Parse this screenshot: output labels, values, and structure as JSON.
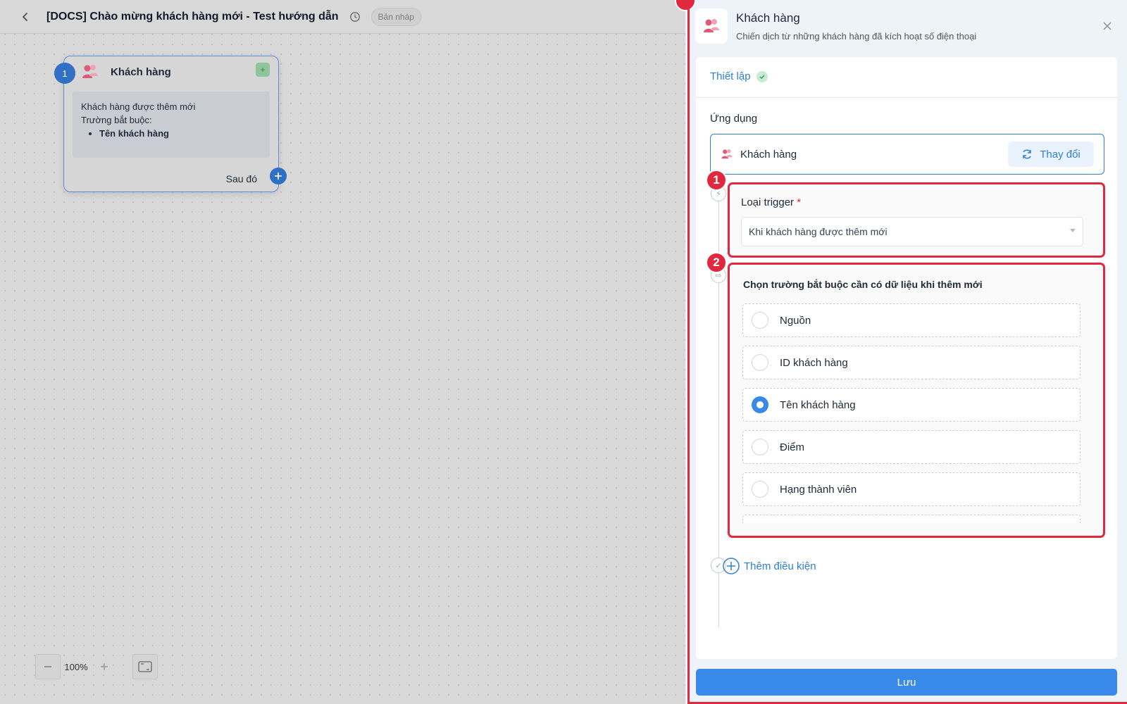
{
  "header": {
    "title": "[DOCS] Chào mừng khách hàng mới - Test hướng dẫn",
    "status_badge": "Bản nháp"
  },
  "node": {
    "step": "1",
    "title": "Khách hàng",
    "description": "Khách hàng được thêm mới",
    "required_label": "Trường bắt buộc:",
    "required_fields": [
      "Tên khách hàng"
    ],
    "next_label": "Sau đó"
  },
  "zoom": {
    "value": "100%"
  },
  "panel": {
    "title": "Khách hàng",
    "subtitle": "Chiến dịch từ những khách hàng đã kích hoạt số điện thoại",
    "tab_label": "Thiết lập",
    "app_section_label": "Ứng dụng",
    "app_name": "Khách hàng",
    "change_label": "Thay đổi",
    "trigger": {
      "badge": "1",
      "label": "Loại trigger",
      "required_mark": "*",
      "value": "Khi khách hàng được thêm mới"
    },
    "fields": {
      "badge": "2",
      "label": "Chọn trường bắt buộc cần có dữ liệu khi thêm mới",
      "options": [
        {
          "label": "Nguồn",
          "selected": false
        },
        {
          "label": "ID khách hàng",
          "selected": false
        },
        {
          "label": "Tên khách hàng",
          "selected": true
        },
        {
          "label": "Điểm",
          "selected": false
        },
        {
          "label": "Hạng thành viên",
          "selected": false
        }
      ]
    },
    "add_condition_label": "Thêm điều kiện",
    "save_label": "Lưu"
  },
  "colors": {
    "accent": "#3a8aea",
    "highlight": "#e0293f",
    "node_step": "#2f6fc4"
  }
}
